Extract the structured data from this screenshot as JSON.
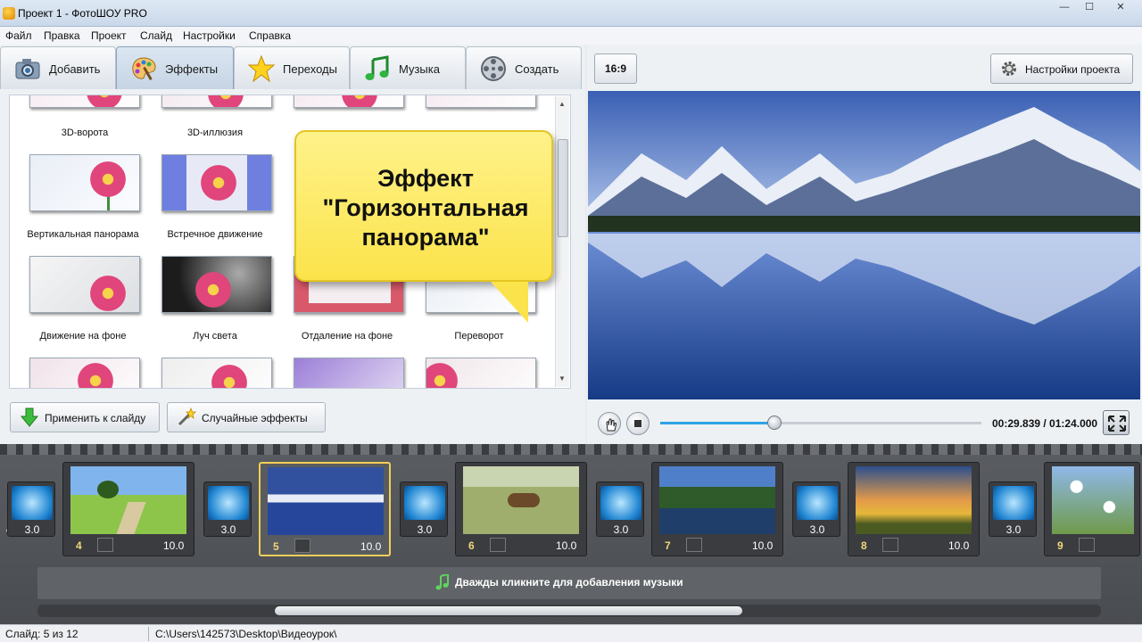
{
  "window": {
    "title": "Проект 1 - ФотоШОУ PRO",
    "minimize": "—",
    "maximize": "☐",
    "close": "✕"
  },
  "menu": [
    "Файл",
    "Правка",
    "Проект",
    "Слайд",
    "Настройки",
    "Справка"
  ],
  "tabs": [
    {
      "label": "Добавить",
      "icon": "camera-icon"
    },
    {
      "label": "Эффекты",
      "icon": "palette-icon",
      "active": true
    },
    {
      "label": "Переходы",
      "icon": "star-icon"
    },
    {
      "label": "Музыка",
      "icon": "music-note-icon"
    },
    {
      "label": "Создать",
      "icon": "film-reel-icon"
    }
  ],
  "effects": {
    "captions": [
      "3D-ворота",
      "3D-иллюзия",
      "Вертикальная панорама",
      "Встречное движение",
      "Движение на фоне",
      "Луч света",
      "Отдаление на фоне",
      "Переворот"
    ],
    "callout": "Эффект \"Горизонтальная панорама\""
  },
  "actions": {
    "apply": "Применить к слайду",
    "random": "Случайные эффекты"
  },
  "preview": {
    "aspect_ratio": "16:9",
    "settings_label": "Настройки проекта",
    "timecode": "00:29.839 / 01:24.000",
    "progress": 0.355
  },
  "timeline": {
    "slides": [
      {
        "number": "4",
        "duration": "10.0",
        "scene": "meadow"
      },
      {
        "number": "5",
        "duration": "10.0",
        "scene": "mountains",
        "selected": true
      },
      {
        "number": "6",
        "duration": "10.0",
        "scene": "deer"
      },
      {
        "number": "7",
        "duration": "10.0",
        "scene": "lake"
      },
      {
        "number": "8",
        "duration": "10.0",
        "scene": "sunset"
      },
      {
        "number": "9",
        "duration": "",
        "scene": "daisies"
      }
    ],
    "transitions": [
      "3.0",
      "3.0",
      "3.0",
      "3.0",
      "3.0",
      "3.0"
    ],
    "music_hint": "Дважды кликните для добавления музыки"
  },
  "status": {
    "slide": "Слайд: 5 из 12",
    "path": "C:\\Users\\142573\\Desktop\\Видеоурок\\"
  },
  "colors": {
    "accent": "#2ea3e6",
    "selected_border": "#f3cf58",
    "callout": "#fbe34b"
  }
}
